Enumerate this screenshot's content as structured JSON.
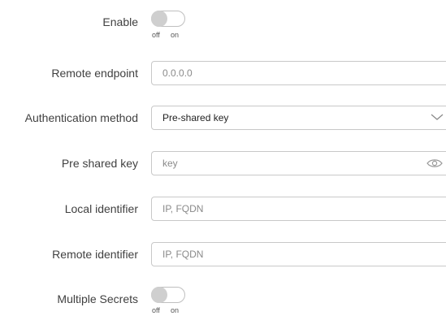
{
  "form": {
    "enable": {
      "label": "Enable",
      "off_text": "off",
      "on_text": "on",
      "state": "off"
    },
    "remote_endpoint": {
      "label": "Remote endpoint",
      "placeholder": "0.0.0.0",
      "value": ""
    },
    "auth_method": {
      "label": "Authentication method",
      "selected": "Pre-shared key"
    },
    "pre_shared_key": {
      "label": "Pre shared key",
      "placeholder": "key",
      "value": "",
      "icon": "eye-icon"
    },
    "local_identifier": {
      "label": "Local identifier",
      "placeholder": "IP, FQDN",
      "value": ""
    },
    "remote_identifier": {
      "label": "Remote identifier",
      "placeholder": "IP, FQDN",
      "value": ""
    },
    "multiple_secrets": {
      "label": "Multiple Secrets",
      "off_text": "off",
      "on_text": "on",
      "state": "off"
    }
  },
  "colors": {
    "border": "#c8c8c8",
    "label": "#404040",
    "toggle_knob": "#cfcfcf"
  }
}
